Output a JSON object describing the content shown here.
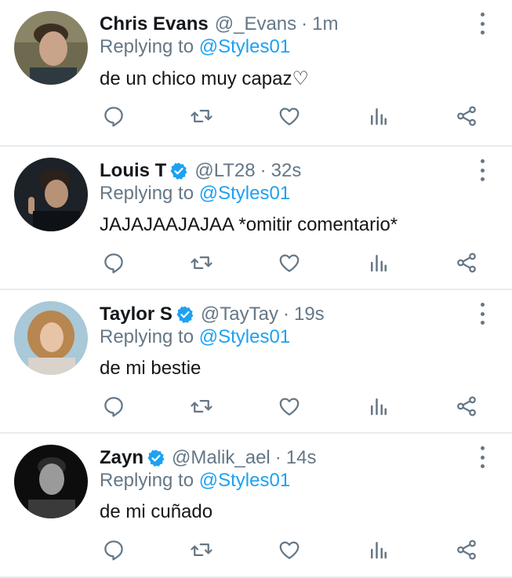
{
  "colors": {
    "name": "#14171a",
    "muted": "#657786",
    "mention": "#1da1f2",
    "verified": "#1da1f2",
    "divider": "#e6ecf0"
  },
  "icons": {
    "reply": "reply-icon",
    "retweet": "retweet-icon",
    "like": "heart-icon",
    "stats": "analytics-icon",
    "share": "share-icon",
    "more": "more-vertical-icon",
    "verified": "verified-badge-icon"
  },
  "tweets": [
    {
      "name": "Chris Evans",
      "verified": false,
      "handle": "@_Evans",
      "separator": "·",
      "time": "1m",
      "replying_prefix": "Replying to",
      "replying_to": "@Styles01",
      "text": "de un chico muy capaz♡"
    },
    {
      "name": "Louis T",
      "verified": true,
      "handle": "@LT28",
      "separator": "·",
      "time": "32s",
      "replying_prefix": "Replying to",
      "replying_to": "@Styles01",
      "text": "JAJAJAAJAJAA *omitir comentario*"
    },
    {
      "name": "Taylor S",
      "verified": true,
      "handle": "@TayTay",
      "separator": "·",
      "time": "19s",
      "replying_prefix": "Replying to",
      "replying_to": "@Styles01",
      "text": "de mi bestie"
    },
    {
      "name": "Zayn",
      "verified": true,
      "handle": "@Malik_ael",
      "separator": "·",
      "time": "14s",
      "replying_prefix": "Replying to",
      "replying_to": "@Styles01",
      "text": "de mi cuñado"
    }
  ]
}
